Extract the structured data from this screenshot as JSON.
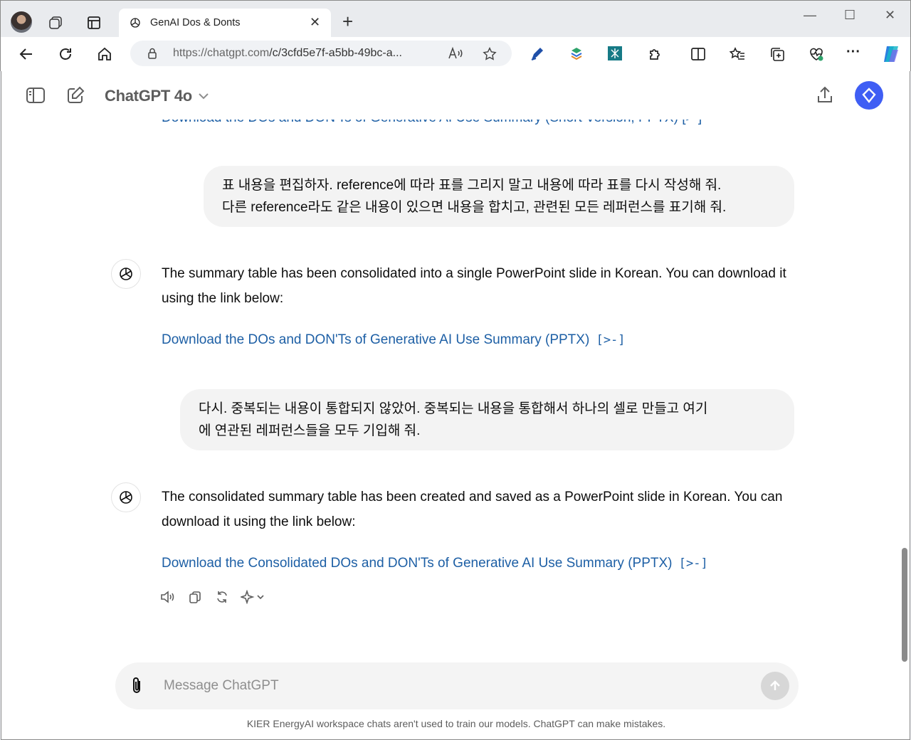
{
  "browser": {
    "tab_title": "GenAI Dos & Donts",
    "url_host": "https://chatgpt.com",
    "url_path": "/c/3cfd5e7f-a5bb-49bc-a...",
    "new_tab": "+",
    "tab_close": "✕",
    "minimize": "—",
    "maximize": "☐",
    "close": "✕",
    "more_menu": "···"
  },
  "app": {
    "model_name": "ChatGPT 4o",
    "composer_placeholder": "Message ChatGPT",
    "footer": "KIER EnergyAI workspace chats aren't used to train our models. ChatGPT can make mistakes."
  },
  "conversation": {
    "partial_link": "Download the DOs and DON'Ts of Generative AI Use Summary (Short Version, PPTX) [>-]",
    "user_message_1_line1": "표 내용을 편집하자. reference에 따라 표를 그리지 말고 내용에 따라 표를 다시 작성해 줘.",
    "user_message_1_line2": "다른 reference라도 같은 내용이 있으면 내용을 합치고, 관련된 모든 레퍼런스를 표기해 줘.",
    "assistant_message_1": "The summary table has been consolidated into a single PowerPoint slide in Korean. You can download it using the link below:",
    "assistant_link_1": "Download the DOs and DON'Ts of Generative AI Use Summary (PPTX)",
    "user_message_2_line1": "다시. 중복되는 내용이 통합되지 않았어. 중복되는 내용을 통합해서 하나의 셀로 만들고 여기",
    "user_message_2_line2": "에 연관된 레퍼런스들을 모두 기입해 줘.",
    "assistant_message_2": "The consolidated summary table has been created and saved as a PowerPoint slide in Korean. You can download it using the link below:",
    "assistant_link_2": "Download the Consolidated DOs and DON'Ts of Generative AI Use Summary (PPTX)",
    "code_indicator": "[>-]"
  },
  "colors": {
    "link": "#1d5fa5",
    "brand_badge": "#3f5ef4",
    "user_bubble": "#f3f3f3"
  }
}
